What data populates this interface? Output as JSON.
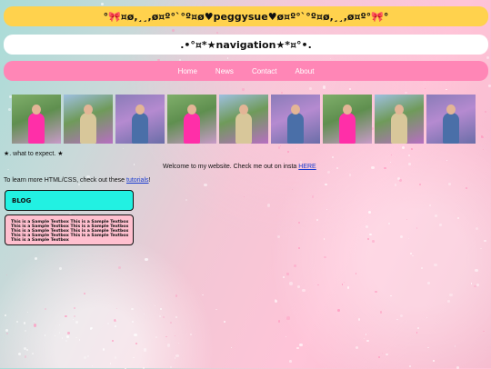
{
  "header": {
    "title": "°🎀¤ø,¸¸,ø¤º°`°º¤ø♥peggysue♥ø¤º°`°º¤ø,¸¸,ø¤º°🎀°"
  },
  "navigation": {
    "heading": ".•°¤*★navigation★*¤°•.",
    "links": [
      "Home",
      "News",
      "Contact",
      "About"
    ]
  },
  "gallery": {
    "photos": [
      {
        "subject": "pink-shirt-peace-sign"
      },
      {
        "subject": "tan-shirt-flowers"
      },
      {
        "subject": "blue-shirt-hydrangeas"
      },
      {
        "subject": "pink-shirt-peace-sign"
      },
      {
        "subject": "tan-shirt-flowers"
      },
      {
        "subject": "blue-shirt-hydrangeas"
      },
      {
        "subject": "pink-shirt-peace-sign"
      },
      {
        "subject": "tan-shirt-flowers"
      },
      {
        "subject": "blue-shirt-hydrangeas"
      }
    ]
  },
  "content": {
    "expect_line": "★. what to expect. ★",
    "welcome_text": "Welcome to my website. Check me out on insta ",
    "welcome_link": "HERE",
    "learn_text": "To learn more HTML/CSS, check out these ",
    "learn_link": "tutorials",
    "learn_suffix": "!",
    "blog_label": "BLOG",
    "sample_text": "This is a Sample Textbox This is a Sample Textbox This is a Sample Textbox This is a Sample Textbox This is a Sample Textbox This is a Sample Textbox This is a Sample Textbox This is a Sample Textbox This is a Sample Textbox"
  },
  "colors": {
    "title_bar": "#ffd24d",
    "nav_header": "#ffffff",
    "nav_links": "#ff86b6",
    "blog_box": "#22f1e2",
    "sample_box": "#ffc0cf"
  }
}
